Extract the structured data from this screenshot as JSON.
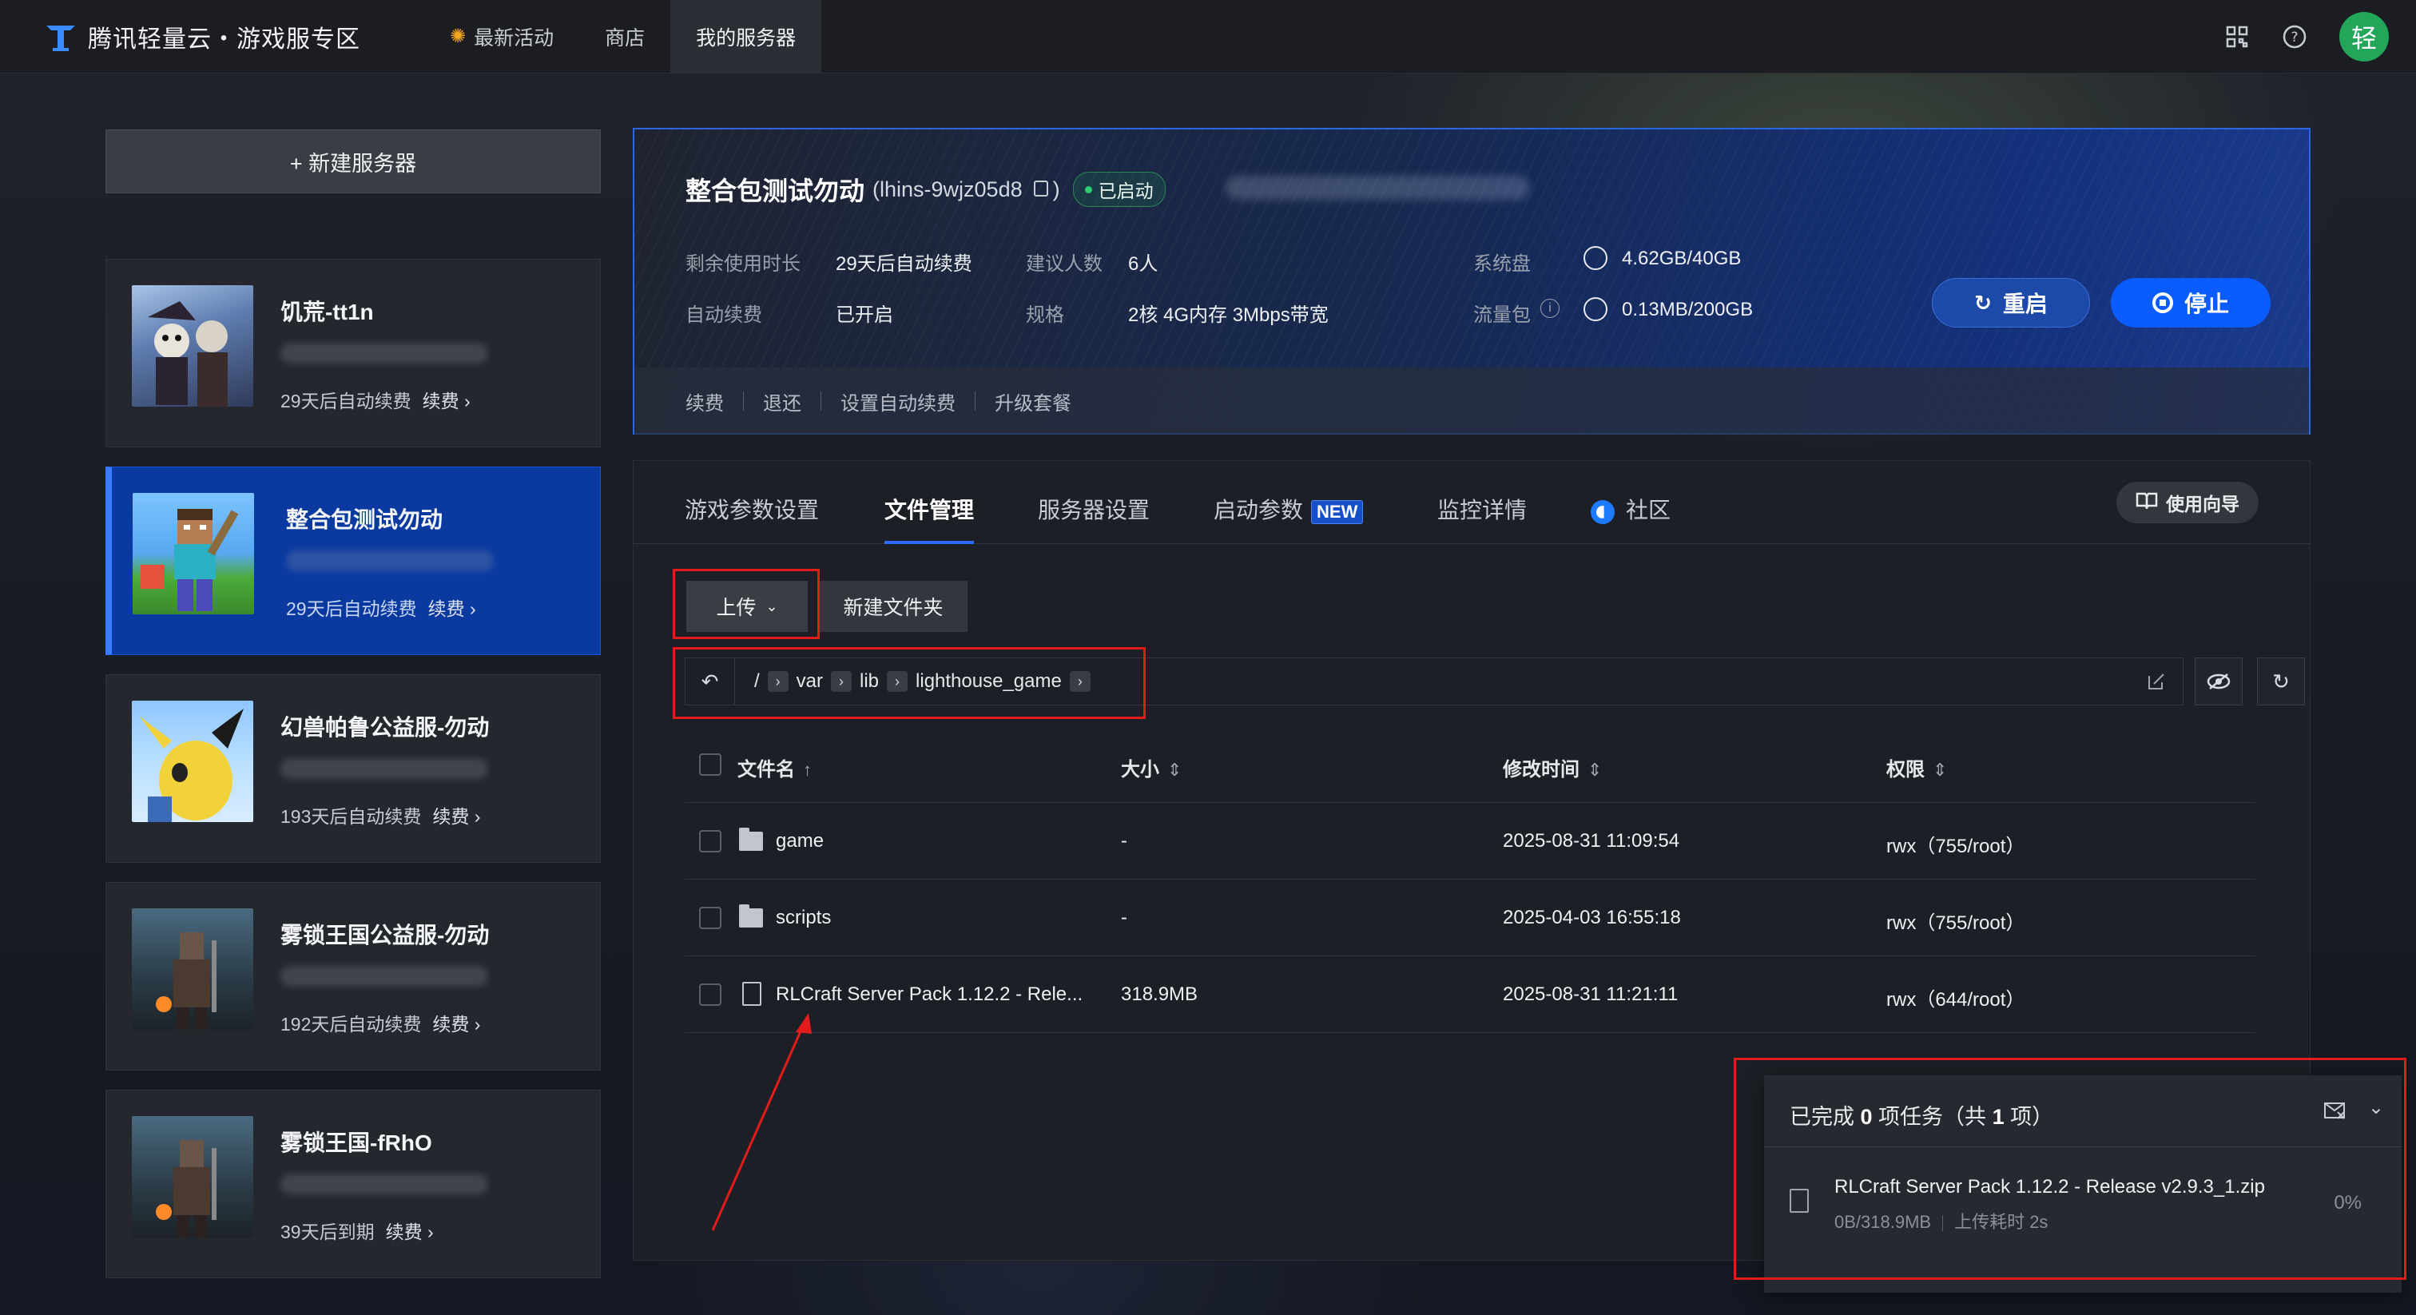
{
  "topbar": {
    "brand": "腾讯轻量云・游戏服专区",
    "nav": [
      {
        "label": "最新活动"
      },
      {
        "label": "商店"
      },
      {
        "label": "我的服务器"
      }
    ],
    "avatar": "轻"
  },
  "sidebar": {
    "new_server_label": "+ 新建服务器",
    "servers": [
      {
        "name": "饥荒-tt1n",
        "renew_text": "29天后自动续费",
        "renew_link": "续费 ›"
      },
      {
        "name": "整合包测试勿动",
        "renew_text": "29天后自动续费",
        "renew_link": "续费 ›"
      },
      {
        "name": "幻兽帕鲁公益服-勿动",
        "renew_text": "193天后自动续费",
        "renew_link": "续费 ›"
      },
      {
        "name": "雾锁王国公益服-勿动",
        "renew_text": "192天后自动续费",
        "renew_link": "续费 ›"
      },
      {
        "name": "雾锁王国-fRhO",
        "renew_text": "39天后到期",
        "renew_link": "续费 ›"
      }
    ]
  },
  "info": {
    "title": "整合包测试勿动",
    "instance_open": "(lhins-9wjz05d8",
    "instance_close": ")",
    "status": "已启动",
    "fields": {
      "remaining_label": "剩余使用时长",
      "remaining_value": "29天后自动续费",
      "players_label": "建议人数",
      "players_value": "6人",
      "disk_label": "系统盘",
      "disk_value": "4.62GB/40GB",
      "autorenew_label": "自动续费",
      "autorenew_value": "已开启",
      "spec_label": "规格",
      "spec_value": "2核 4G内存 3Mbps带宽",
      "traffic_label": "流量包",
      "traffic_value": "0.13MB/200GB"
    },
    "restart_label": "重启",
    "stop_label": "停止",
    "footer_links": [
      "续费",
      "退还",
      "设置自动续费",
      "升级套餐"
    ]
  },
  "main": {
    "tabs": [
      {
        "label": "游戏参数设置"
      },
      {
        "label": "文件管理"
      },
      {
        "label": "服务器设置"
      },
      {
        "label": "启动参数"
      },
      {
        "label": "监控详情"
      },
      {
        "label": "社区"
      }
    ],
    "new_badge": "NEW",
    "guide_label": "使用向导",
    "upload_label": "上传",
    "new_folder_label": "新建文件夹",
    "path": [
      "/",
      "var",
      "lib",
      "lighthouse_game"
    ],
    "columns": {
      "name": "文件名",
      "size": "大小",
      "modified": "修改时间",
      "perm": "权限"
    },
    "files": [
      {
        "name": "game",
        "type": "folder",
        "size": "-",
        "modified": "2025-08-31 11:09:54",
        "perm": "rwx（755/root）"
      },
      {
        "name": "scripts",
        "type": "folder",
        "size": "-",
        "modified": "2025-04-03 16:55:18",
        "perm": "rwx（755/root）"
      },
      {
        "name": "RLCraft Server Pack 1.12.2 - Rele...",
        "type": "file",
        "size": "318.9MB",
        "modified": "2025-08-31 11:21:11",
        "perm": "rwx（644/root）"
      }
    ]
  },
  "upload_panel": {
    "title_prefix": "已完成 ",
    "done_count": "0",
    "title_mid": " 项任务（共 ",
    "total_count": "1",
    "title_suffix": " 项）",
    "file_name": "RLCraft Server Pack 1.12.2 - Release v2.9.3_1.zip",
    "progress_text": "0B/318.9MB",
    "elapsed_text": "上传耗时 2s",
    "percent": "0%"
  },
  "colors": {
    "accent": "#0a5cff",
    "active_card": "#0a3aa0",
    "annotation": "#e21b1b",
    "status_ok": "#2ecc71"
  }
}
